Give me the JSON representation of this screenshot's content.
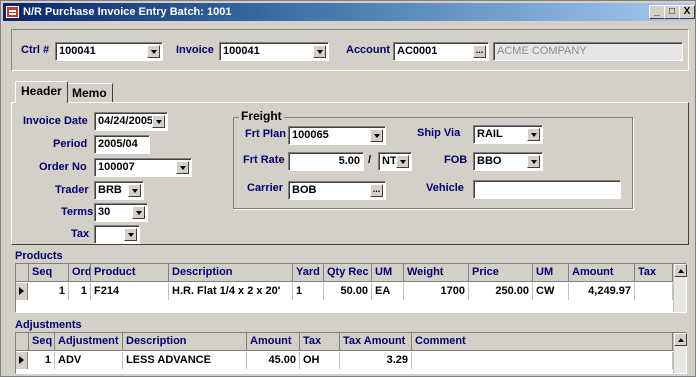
{
  "window": {
    "title": "N/R Purchase Invoice Entry Batch: 1001",
    "controls": [
      "_",
      "□",
      "X"
    ]
  },
  "top": {
    "ctrl_label": "Ctrl #",
    "ctrl_value": "100041",
    "invoice_label": "Invoice",
    "invoice_value": "100041",
    "account_label": "Account",
    "account_value": "AC0001",
    "account_name": "ACME COMPANY"
  },
  "tabs": [
    {
      "label": "Header"
    },
    {
      "label": "Memo"
    }
  ],
  "header": {
    "invoice_date_label": "Invoice Date",
    "invoice_date": "04/24/2005",
    "period_label": "Period",
    "period": "2005/04",
    "order_no_label": "Order No",
    "order_no": "100007",
    "trader_label": "Trader",
    "trader": "BRB",
    "terms_label": "Terms",
    "terms": "30",
    "tax_label": "Tax",
    "tax": ""
  },
  "freight": {
    "title": "Freight",
    "frt_plan_label": "Frt Plan",
    "frt_plan": "100065",
    "frt_rate_label": "Frt Rate",
    "frt_rate": "5.00",
    "rate_sep": "/",
    "rate_unit": "NT",
    "carrier_label": "Carrier",
    "carrier": "BOB",
    "ship_via_label": "Ship Via",
    "ship_via": "RAIL",
    "fob_label": "FOB",
    "fob": "BBO",
    "vehicle_label": "Vehicle",
    "vehicle": ""
  },
  "products": {
    "title": "Products",
    "columns": [
      "Seq",
      "Ord",
      "Product",
      "Description",
      "Yard",
      "Qty Rec",
      "UM",
      "Weight",
      "Price",
      "UM",
      "Amount",
      "Tax"
    ],
    "rows": [
      [
        "1",
        "1",
        "F214",
        "H.R. Flat 1/4 x 2 x 20'",
        "1",
        "50.00",
        "EA",
        "1700",
        "250.00",
        "CW",
        "4,249.97",
        ""
      ]
    ]
  },
  "adjustments": {
    "title": "Adjustments",
    "columns": [
      "Seq",
      "Adjustment",
      "Description",
      "Amount",
      "Tax",
      "Tax Amount",
      "Comment"
    ],
    "rows": [
      [
        "1",
        "ADV",
        "LESS ADVANCE",
        "45.00",
        "OH",
        "3.29",
        ""
      ]
    ]
  }
}
